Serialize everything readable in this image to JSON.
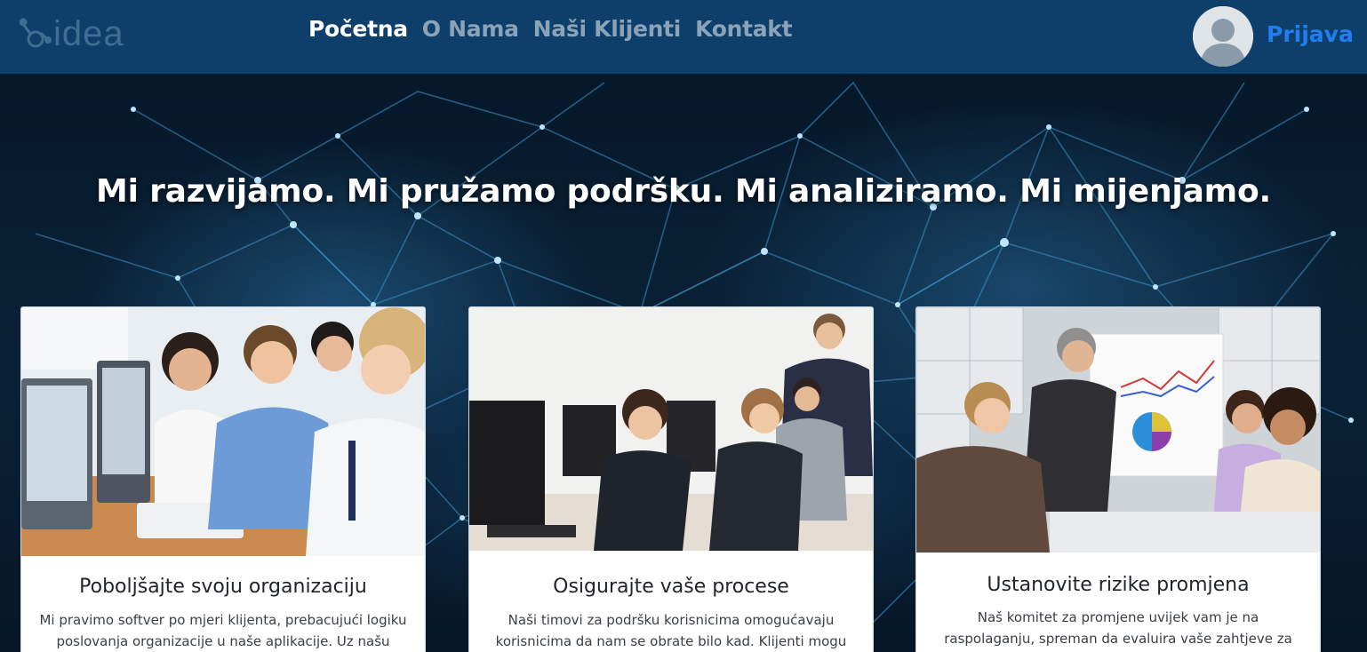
{
  "brand": {
    "logo_text": "idea",
    "logo_icon": "molecule-icon"
  },
  "nav": {
    "items": [
      {
        "label": "Početna",
        "active": true
      },
      {
        "label": "O Nama",
        "active": false
      },
      {
        "label": "Naši Klijenti",
        "active": false
      },
      {
        "label": "Kontakt",
        "active": false
      }
    ],
    "login_label": "Prijava",
    "avatar_icon": "user-avatar-icon"
  },
  "hero": {
    "headline": "Mi razvijamo. Mi pružamo podršku. Mi analiziramo. Mi mijenjamo.",
    "background": "network-nodes-image"
  },
  "cards": [
    {
      "image": "team-at-computers-photo",
      "title": "Poboljšajte svoju organizaciju",
      "text": "Mi pravimo softver po mjeri klijenta, prebacujući logiku poslovanja organizacije u naše aplikacije. Uz našu pomoć,"
    },
    {
      "image": "call-center-photo",
      "title": "Osigurajte vaše procese",
      "text": "Naši timovi za podršku korisnicima omogućavaju korisnicima da nam se obrate bilo kad. Klijenti mogu slati"
    },
    {
      "image": "presentation-meeting-photo",
      "title": "Ustanovite rizike promjena",
      "text": "Naš komitet za promjene uvijek vam je na raspolaganju, spreman da evaluira vaše zahtjeve za promjenama i piše"
    }
  ],
  "colors": {
    "navbar": "#0e3f6b",
    "nav_active": "#ffffff",
    "nav_inactive": "#8ba3b8",
    "login": "#1f7ff0"
  }
}
